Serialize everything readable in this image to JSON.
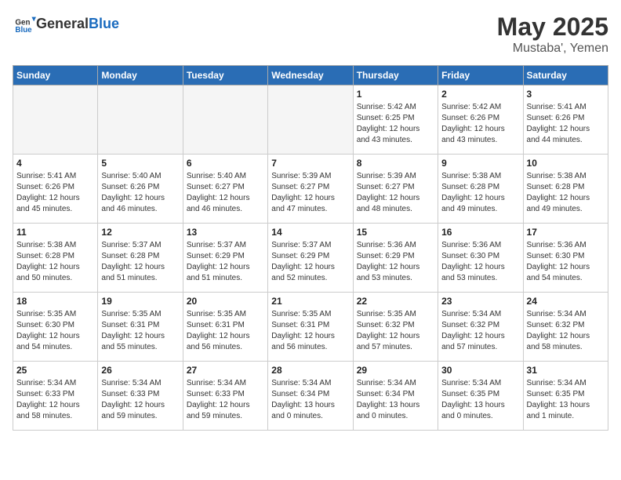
{
  "header": {
    "logo_general": "General",
    "logo_blue": "Blue",
    "month_year": "May 2025",
    "location": "Mustaba', Yemen"
  },
  "weekdays": [
    "Sunday",
    "Monday",
    "Tuesday",
    "Wednesday",
    "Thursday",
    "Friday",
    "Saturday"
  ],
  "weeks": [
    [
      {
        "day": "",
        "info": ""
      },
      {
        "day": "",
        "info": ""
      },
      {
        "day": "",
        "info": ""
      },
      {
        "day": "",
        "info": ""
      },
      {
        "day": "1",
        "info": "Sunrise: 5:42 AM\nSunset: 6:25 PM\nDaylight: 12 hours\nand 43 minutes."
      },
      {
        "day": "2",
        "info": "Sunrise: 5:42 AM\nSunset: 6:26 PM\nDaylight: 12 hours\nand 43 minutes."
      },
      {
        "day": "3",
        "info": "Sunrise: 5:41 AM\nSunset: 6:26 PM\nDaylight: 12 hours\nand 44 minutes."
      }
    ],
    [
      {
        "day": "4",
        "info": "Sunrise: 5:41 AM\nSunset: 6:26 PM\nDaylight: 12 hours\nand 45 minutes."
      },
      {
        "day": "5",
        "info": "Sunrise: 5:40 AM\nSunset: 6:26 PM\nDaylight: 12 hours\nand 46 minutes."
      },
      {
        "day": "6",
        "info": "Sunrise: 5:40 AM\nSunset: 6:27 PM\nDaylight: 12 hours\nand 46 minutes."
      },
      {
        "day": "7",
        "info": "Sunrise: 5:39 AM\nSunset: 6:27 PM\nDaylight: 12 hours\nand 47 minutes."
      },
      {
        "day": "8",
        "info": "Sunrise: 5:39 AM\nSunset: 6:27 PM\nDaylight: 12 hours\nand 48 minutes."
      },
      {
        "day": "9",
        "info": "Sunrise: 5:38 AM\nSunset: 6:28 PM\nDaylight: 12 hours\nand 49 minutes."
      },
      {
        "day": "10",
        "info": "Sunrise: 5:38 AM\nSunset: 6:28 PM\nDaylight: 12 hours\nand 49 minutes."
      }
    ],
    [
      {
        "day": "11",
        "info": "Sunrise: 5:38 AM\nSunset: 6:28 PM\nDaylight: 12 hours\nand 50 minutes."
      },
      {
        "day": "12",
        "info": "Sunrise: 5:37 AM\nSunset: 6:28 PM\nDaylight: 12 hours\nand 51 minutes."
      },
      {
        "day": "13",
        "info": "Sunrise: 5:37 AM\nSunset: 6:29 PM\nDaylight: 12 hours\nand 51 minutes."
      },
      {
        "day": "14",
        "info": "Sunrise: 5:37 AM\nSunset: 6:29 PM\nDaylight: 12 hours\nand 52 minutes."
      },
      {
        "day": "15",
        "info": "Sunrise: 5:36 AM\nSunset: 6:29 PM\nDaylight: 12 hours\nand 53 minutes."
      },
      {
        "day": "16",
        "info": "Sunrise: 5:36 AM\nSunset: 6:30 PM\nDaylight: 12 hours\nand 53 minutes."
      },
      {
        "day": "17",
        "info": "Sunrise: 5:36 AM\nSunset: 6:30 PM\nDaylight: 12 hours\nand 54 minutes."
      }
    ],
    [
      {
        "day": "18",
        "info": "Sunrise: 5:35 AM\nSunset: 6:30 PM\nDaylight: 12 hours\nand 54 minutes."
      },
      {
        "day": "19",
        "info": "Sunrise: 5:35 AM\nSunset: 6:31 PM\nDaylight: 12 hours\nand 55 minutes."
      },
      {
        "day": "20",
        "info": "Sunrise: 5:35 AM\nSunset: 6:31 PM\nDaylight: 12 hours\nand 56 minutes."
      },
      {
        "day": "21",
        "info": "Sunrise: 5:35 AM\nSunset: 6:31 PM\nDaylight: 12 hours\nand 56 minutes."
      },
      {
        "day": "22",
        "info": "Sunrise: 5:35 AM\nSunset: 6:32 PM\nDaylight: 12 hours\nand 57 minutes."
      },
      {
        "day": "23",
        "info": "Sunrise: 5:34 AM\nSunset: 6:32 PM\nDaylight: 12 hours\nand 57 minutes."
      },
      {
        "day": "24",
        "info": "Sunrise: 5:34 AM\nSunset: 6:32 PM\nDaylight: 12 hours\nand 58 minutes."
      }
    ],
    [
      {
        "day": "25",
        "info": "Sunrise: 5:34 AM\nSunset: 6:33 PM\nDaylight: 12 hours\nand 58 minutes."
      },
      {
        "day": "26",
        "info": "Sunrise: 5:34 AM\nSunset: 6:33 PM\nDaylight: 12 hours\nand 59 minutes."
      },
      {
        "day": "27",
        "info": "Sunrise: 5:34 AM\nSunset: 6:33 PM\nDaylight: 12 hours\nand 59 minutes."
      },
      {
        "day": "28",
        "info": "Sunrise: 5:34 AM\nSunset: 6:34 PM\nDaylight: 13 hours\nand 0 minutes."
      },
      {
        "day": "29",
        "info": "Sunrise: 5:34 AM\nSunset: 6:34 PM\nDaylight: 13 hours\nand 0 minutes."
      },
      {
        "day": "30",
        "info": "Sunrise: 5:34 AM\nSunset: 6:35 PM\nDaylight: 13 hours\nand 0 minutes."
      },
      {
        "day": "31",
        "info": "Sunrise: 5:34 AM\nSunset: 6:35 PM\nDaylight: 13 hours\nand 1 minute."
      }
    ]
  ]
}
